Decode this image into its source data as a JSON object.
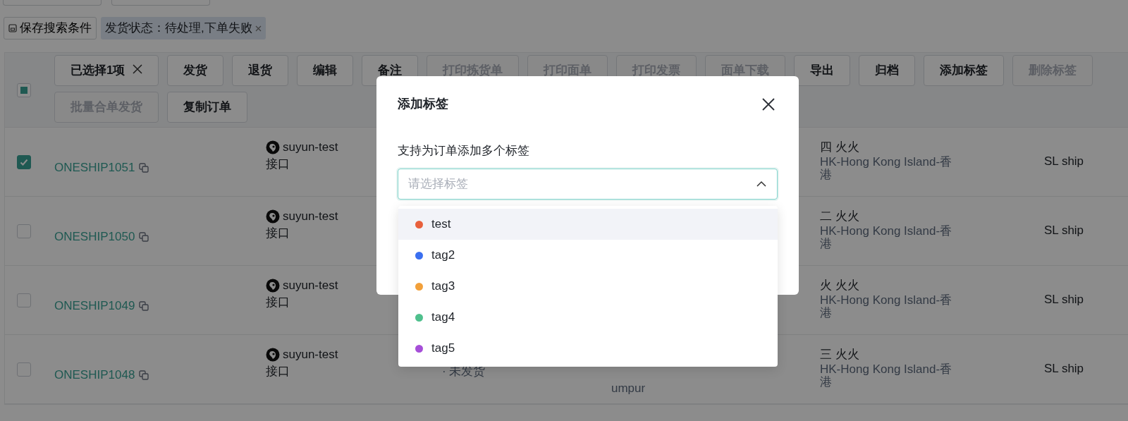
{
  "saved_search_button": {
    "label": "保存搜索条件"
  },
  "filter_tags": [
    {
      "label": "发货状态：待处理,下单失败"
    }
  ],
  "header": {
    "indeterminate": true,
    "selection": "已选择1项",
    "action_rows": [
      [
        {
          "label": "发货",
          "disabled": false
        },
        {
          "label": "退货",
          "disabled": false
        },
        {
          "label": "编辑",
          "disabled": false
        },
        {
          "label": "备注",
          "disabled": false
        },
        {
          "label": "打印拣货单",
          "disabled": true
        },
        {
          "label": "打印面单",
          "disabled": true
        },
        {
          "label": "打印发票",
          "disabled": true
        },
        {
          "label": "面单下载",
          "disabled": true
        },
        {
          "label": "导出",
          "disabled": false
        },
        {
          "label": "归档",
          "disabled": false
        },
        {
          "label": "添加标签",
          "disabled": false
        },
        {
          "label": "删除标签",
          "disabled": true
        }
      ],
      [
        {
          "label": "批量合单发货",
          "disabled": true
        },
        {
          "label": "复制订单",
          "disabled": false
        }
      ]
    ]
  },
  "rows": [
    {
      "selected": true,
      "order_no": "ONESHIP1051",
      "store": "suyun-test",
      "channel": "接口",
      "recipient": "四 火火",
      "region": "HK-Hong Kong Island-香港",
      "shipping": "SL ship"
    },
    {
      "selected": false,
      "order_no": "ONESHIP1050",
      "store": "suyun-test",
      "channel": "接口",
      "recipient": "二 火火",
      "region": "HK-Hong Kong Island-香港",
      "shipping": "SL ship"
    },
    {
      "selected": false,
      "order_no": "ONESHIP1049",
      "store": "suyun-test",
      "channel": "接口",
      "recipient": "火 火火",
      "region": "HK-Hong Kong Island-香港",
      "shipping": "SL ship"
    },
    {
      "selected": false,
      "order_no": "ONESHIP1048",
      "store": "suyun-test",
      "channel": "接口",
      "status": "· 未发货",
      "address": "umpur",
      "recipient": "三 火火",
      "region": "HK-Hong Kong Island-香港",
      "shipping": "SL ship"
    }
  ],
  "modal": {
    "title": "添加标签",
    "label": "支持为订单添加多个标签",
    "select": {
      "placeholder": "请选择标签",
      "expanded": true
    },
    "options": [
      {
        "label": "test",
        "color": "#e8603c",
        "highlighted": true,
        "selected": false
      },
      {
        "label": "tag2",
        "color": "#3a6ff0",
        "highlighted": false,
        "selected": false
      },
      {
        "label": "tag3",
        "color": "#f2a03a",
        "highlighted": false,
        "selected": false
      },
      {
        "label": "tag4",
        "color": "#4fc08d",
        "highlighted": false,
        "selected": false
      },
      {
        "label": "tag5",
        "color": "#a64fd8",
        "highlighted": false,
        "selected": false
      }
    ]
  }
}
